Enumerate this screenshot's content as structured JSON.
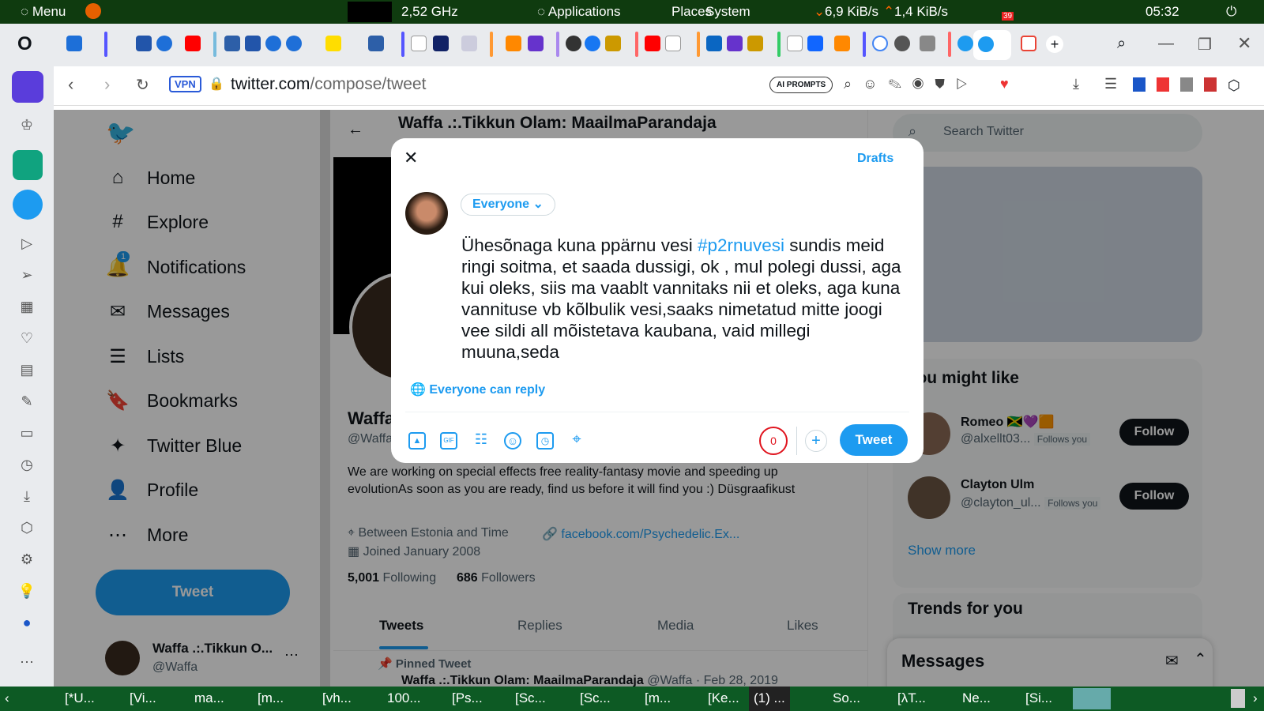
{
  "top_panel": {
    "menu": "Menu",
    "cpu": "2,52 GHz",
    "applications": "Applications",
    "places": "Places",
    "system": "System",
    "net_down": "6,9 KiB/s",
    "net_up": "1,4 KiB/s",
    "telegram_badge": "39",
    "clock": "05:32"
  },
  "browser": {
    "url_host": "twitter.com",
    "url_path": "/compose/tweet",
    "vpn": "VPN",
    "ai_prompts": "AI PROMPTS"
  },
  "twitter": {
    "nav": [
      {
        "label": "Home",
        "icon": "⌂"
      },
      {
        "label": "Explore",
        "icon": "#"
      },
      {
        "label": "Notifications",
        "icon": "🔔",
        "badge": "1"
      },
      {
        "label": "Messages",
        "icon": "✉"
      },
      {
        "label": "Lists",
        "icon": "☰"
      },
      {
        "label": "Bookmarks",
        "icon": "🔖"
      },
      {
        "label": "Twitter Blue",
        "icon": "✦"
      },
      {
        "label": "Profile",
        "icon": "👤"
      },
      {
        "label": "More",
        "icon": "⋯"
      }
    ],
    "tweet_button": "Tweet",
    "account": {
      "name": "Waffa .:.Tikkun O...",
      "handle": "@Waffa"
    },
    "profile": {
      "header_title": "Waffa .:.Tikkun Olam: MaailmaParandaja",
      "name_partial": "Waffa",
      "handle_partial": "@Waffa",
      "bio": "We are working on special effects free reality-fantasy movie and speeding up evolutionAs soon as you are ready, find us before it will find you :) Düsgraafikust",
      "location": "Between Estonia and Time",
      "link": "facebook.com/Psychedelic.Ex...",
      "joined": "Joined January 2008",
      "following_count": "5,001",
      "following_label": "Following",
      "followers_count": "686",
      "followers_label": "Followers",
      "tabs": [
        "Tweets",
        "Replies",
        "Media",
        "Likes"
      ],
      "pinned": "Pinned Tweet",
      "pinned_author": "Waffa .:.Tikkun Olam: MaailmaParandaja",
      "pinned_meta": "@Waffa · Feb 28, 2019"
    },
    "search_placeholder": "Search Twitter",
    "who_to_follow": {
      "title": "You might like",
      "users": [
        {
          "name": "Romeo",
          "handle": "@alxellt03...",
          "follows_you": "Follows you",
          "button": "Follow"
        },
        {
          "name": "Clayton Ulm",
          "handle": "@clayton_ul...",
          "follows_you": "Follows you",
          "button": "Follow"
        }
      ],
      "show_more": "Show more"
    },
    "trends_title": "Trends for you",
    "messages_title": "Messages"
  },
  "compose": {
    "drafts": "Drafts",
    "audience": "Everyone",
    "text_before": "Ühesõnaga kuna ppärnu vesi ",
    "hashtag": "#p2rnuvesi",
    "text_after": " sundis meid ringi soitma, et saada dussigi, ok , mul polegi dussi, aga kui oleks, siis ma vaablt vannitaks nii et oleks, aga kuna vannituse vb kõlbulik vesi,saaks nimetatud mitte joogi vee sildi all mõistetava kaubana, vaid millegi muuna,seda",
    "reply_setting": "Everyone can reply",
    "char_count": "0",
    "submit": "Tweet"
  },
  "taskbar": {
    "items": [
      "[*U...",
      "[Vi...",
      "ma...",
      "[m...",
      "[vh...",
      "100...",
      "[Ps...",
      "[Sc...",
      "[Sc...",
      "[m...",
      "[Ke...",
      "(1) ...",
      "So...",
      "[λT...",
      "Ne...",
      "[Si..."
    ]
  }
}
